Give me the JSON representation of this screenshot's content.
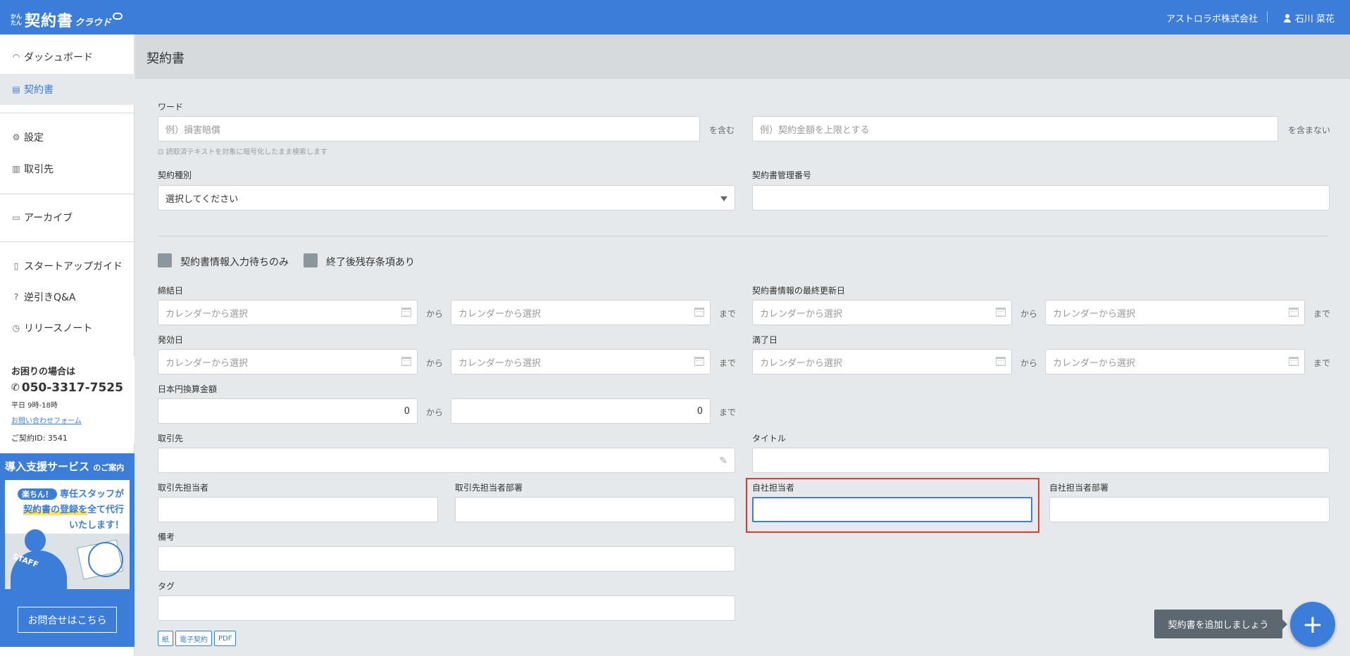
{
  "header": {
    "logo_small": "かんたん",
    "logo_main": "契約書",
    "logo_sub": "クラウド",
    "company": "アストロラボ株式会社",
    "user_name": "石川 菜花"
  },
  "sidebar": {
    "items": [
      {
        "label": "ダッシュボード",
        "icon": "dashboard-icon"
      },
      {
        "label": "契約書",
        "icon": "document-icon"
      },
      {
        "label": "設定",
        "icon": "gear-icon"
      },
      {
        "label": "取引先",
        "icon": "building-icon"
      },
      {
        "label": "アーカイブ",
        "icon": "archive-icon"
      },
      {
        "label": "スタートアップガイド",
        "icon": "book-icon"
      },
      {
        "label": "逆引きQ&A",
        "icon": "question-icon"
      },
      {
        "label": "リリースノート",
        "icon": "clock-icon"
      }
    ],
    "help": {
      "title": "お困りの場合は",
      "phone": "050-3317-7525",
      "hours": "平日 9時-18時",
      "form_link": "お問い合わせフォーム",
      "contract_id": "ご契約ID: 3541"
    },
    "promo": {
      "title": "導入支援サービス",
      "title_small": "のご案内",
      "tag": "楽ちん！",
      "line1": "専任スタッフが",
      "line2_hl": "契約書の登録を",
      "line2_rest": "全て代行",
      "line3": "いたします！",
      "staff_label": "STAFF",
      "button": "お問合せはこちら"
    }
  },
  "page": {
    "title": "契約書"
  },
  "form": {
    "word_label": "ワード",
    "include_placeholder": "例）損害賠償",
    "include_suffix": "を含む",
    "exclude_placeholder": "例）契約金額を上限とする",
    "exclude_suffix": "を含まない",
    "hint": "読取済テキストを対象に暗号化したまま検索します",
    "type_label": "契約種別",
    "type_value": "選択してください",
    "number_label": "契約書管理番号",
    "check1": "契約書情報入力待ちのみ",
    "check2": "終了後残存条項あり",
    "date_placeholder": "カレンダーから選択",
    "from": "から",
    "to": "まで",
    "signed_label": "締結日",
    "updated_label": "契約書情報の最終更新日",
    "effective_label": "発効日",
    "expiry_label": "満了日",
    "amount_label": "日本円換算金額",
    "amount_from": "0",
    "amount_to": "0",
    "partner_label": "取引先",
    "title_label": "タイトル",
    "partner_person_label": "取引先担当者",
    "partner_dept_label": "取引先担当者部署",
    "own_person_label": "自社担当者",
    "own_dept_label": "自社担当者部署",
    "notes_label": "備考",
    "tag_label": "タグ",
    "tags": [
      "紙",
      "電子契約",
      "PDF"
    ]
  },
  "fab": {
    "tooltip": "契約書を追加しましょう",
    "icon": "plus-icon"
  },
  "colors": {
    "brand": "#3b7dd8",
    "highlight": "#e53b2c"
  }
}
